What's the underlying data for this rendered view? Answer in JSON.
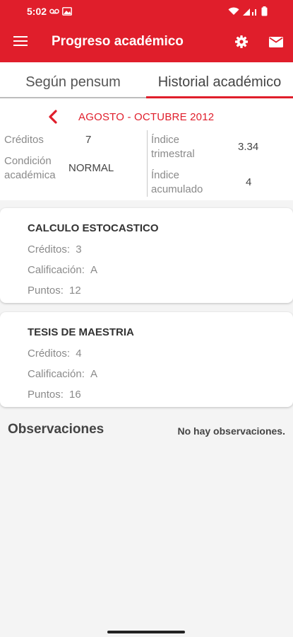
{
  "status_bar": {
    "time": "5:02",
    "icons": [
      "voicemail-icon",
      "image-icon",
      "wifi-icon",
      "signal-icon",
      "battery-icon"
    ]
  },
  "app_bar": {
    "title": "Progreso académico",
    "color": "#e01e2b",
    "icons": [
      "menu-icon",
      "gear-icon",
      "mail-icon"
    ]
  },
  "tabs": [
    {
      "label": "Según pensum",
      "selected": false
    },
    {
      "label": "Historial académico",
      "selected": true
    }
  ],
  "summary": {
    "period": "AGOSTO - OCTUBRE 2012",
    "creditos_label": "Créditos",
    "creditos_value": "7",
    "condicion_label_1": "Condición",
    "condicion_label_2": "académica",
    "condicion_value": "NORMAL",
    "indice_trimestral_label_1": "Índice",
    "indice_trimestral_label_2": "trimestral",
    "indice_trimestral_value": "3.34",
    "indice_acumulado_label_1": "Índice",
    "indice_acumulado_label_2": "acumulado",
    "indice_acumulado_value": "4"
  },
  "courses": [
    {
      "name": "CALCULO ESTOCASTICO",
      "creditos_label": "Créditos:",
      "creditos": "3",
      "calificacion_label": "Calificación:",
      "calificacion": "A",
      "puntos_label": "Puntos:",
      "puntos": "12"
    },
    {
      "name": "TESIS DE MAESTRIA",
      "creditos_label": "Créditos:",
      "creditos": "4",
      "calificacion_label": "Calificación:",
      "calificacion": "A",
      "puntos_label": "Puntos:",
      "puntos": "16"
    }
  ],
  "observaciones": {
    "title": "Observaciones",
    "text": "No hay observaciones."
  }
}
